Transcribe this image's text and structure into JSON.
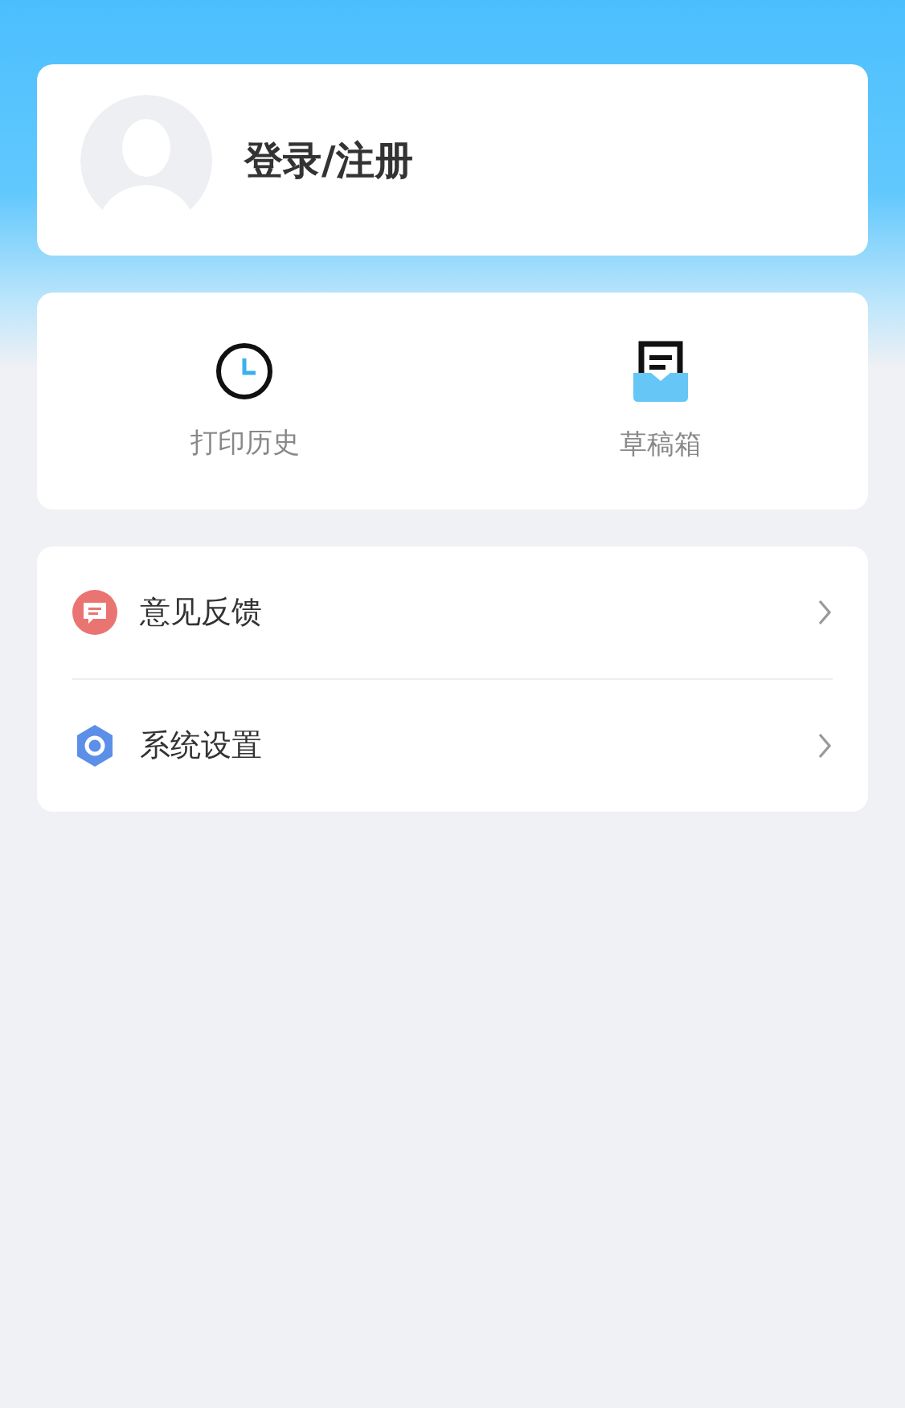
{
  "profile": {
    "login_label": "登录/注册"
  },
  "shortcuts": [
    {
      "kind": "history",
      "label": "打印历史"
    },
    {
      "kind": "drafts",
      "label": "草稿箱"
    }
  ],
  "menu": [
    {
      "kind": "feedback",
      "label": "意见反馈"
    },
    {
      "kind": "settings",
      "label": "系统设置"
    }
  ]
}
